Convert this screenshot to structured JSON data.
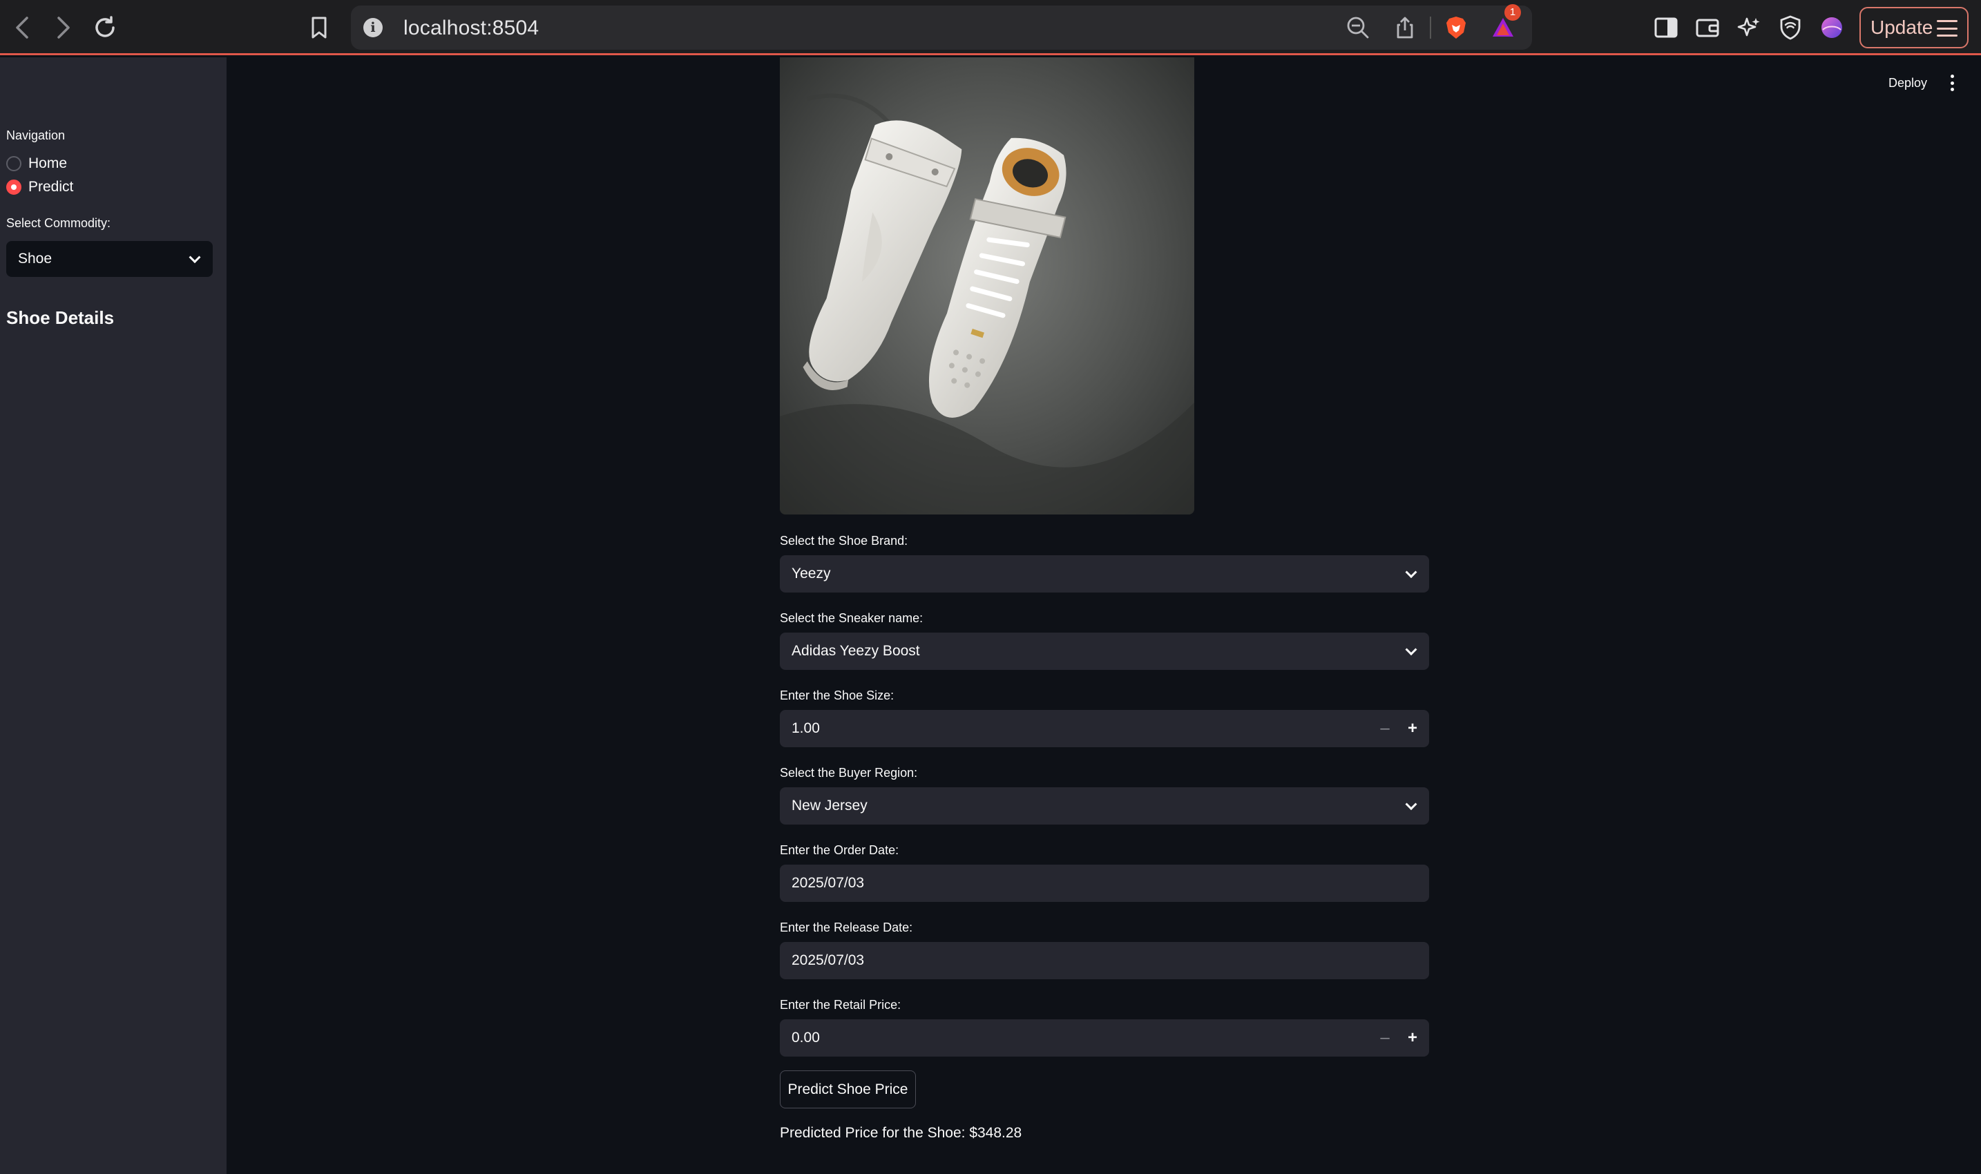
{
  "browser": {
    "url": "localhost:8504",
    "update_label": "Update",
    "alert_count": "1"
  },
  "sidebar": {
    "nav_label": "Navigation",
    "nav_options": [
      {
        "label": "Home",
        "selected": false
      },
      {
        "label": "Predict",
        "selected": true
      }
    ],
    "commodity_label": "Select Commodity:",
    "commodity_value": "Shoe",
    "heading": "Shoe Details"
  },
  "header": {
    "deploy_label": "Deploy"
  },
  "form": {
    "brand_label": "Select the Shoe Brand:",
    "brand_value": "Yeezy",
    "sneaker_label": "Select the Sneaker name:",
    "sneaker_value": "Adidas Yeezy Boost",
    "size_label": "Enter the Shoe Size:",
    "size_value": "1.00",
    "region_label": "Select the Buyer Region:",
    "region_value": "New Jersey",
    "order_date_label": "Enter the Order Date:",
    "order_date_value": "2025/07/03",
    "release_date_label": "Enter the Release Date:",
    "release_date_value": "2025/07/03",
    "retail_label": "Enter the Retail Price:",
    "retail_value": "0.00",
    "predict_button": "Predict Shoe Price",
    "result_text": "Predicted Price for the Shoe: $348.28"
  },
  "colors": {
    "accent": "#ff4b4b",
    "background": "#0e1117",
    "sidebar": "#262730",
    "input_bg": "#262730"
  }
}
